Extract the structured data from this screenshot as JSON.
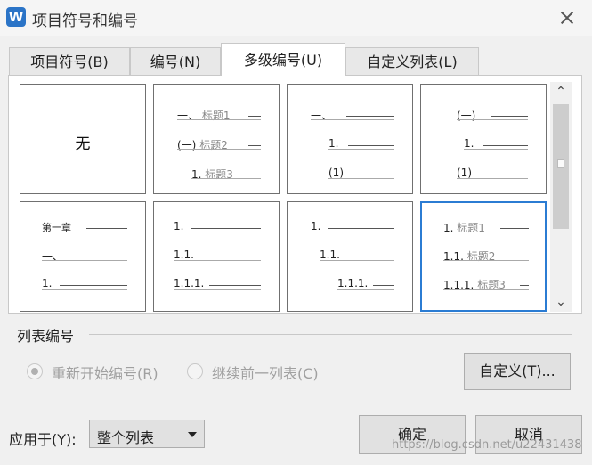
{
  "window": {
    "title": "项目符号和编号",
    "app_icon": "W"
  },
  "tabs": [
    {
      "label": "项目符号(B)",
      "active": false
    },
    {
      "label": "编号(N)",
      "active": false
    },
    {
      "label": "多级编号(U)",
      "active": true
    },
    {
      "label": "自定义列表(L)",
      "active": false
    }
  ],
  "presets": {
    "p1": {
      "label": "无"
    },
    "p2": {
      "r1": "一、",
      "r1h": "标题1",
      "r2": "(一)",
      "r2h": "标题2",
      "r3": "1.",
      "r3h": "标题3"
    },
    "p3": {
      "r1": "一、",
      "r2": "1.",
      "r3": "(1)"
    },
    "p4": {
      "r1": "(一)",
      "r2": "1.",
      "r3": "(1)"
    },
    "p5": {
      "r1": "第一章",
      "r2": "一、",
      "r3": "1."
    },
    "p6": {
      "r1": "1.",
      "r2": "1.1.",
      "r3": "1.1.1."
    },
    "p7": {
      "r1": "1.",
      "r2": "1.1.",
      "r3": "1.1.1."
    },
    "p8": {
      "r1": "1.",
      "r1h": "标题1",
      "r2": "1.1.",
      "r2h": "标题2",
      "r3": "1.1.1.",
      "r3h": "标题3",
      "selected": true
    }
  },
  "list_numbering": {
    "section_label": "列表编号",
    "restart_label": "重新开始编号(R)",
    "continue_label": "继续前一列表(C)",
    "customize_label": "自定义(T)..."
  },
  "footer": {
    "apply_label": "应用于(Y):",
    "apply_value": "整个列表",
    "ok_label": "确定",
    "cancel_label": "取消"
  },
  "watermark": "https://blog.csdn.net/u22431438",
  "colors": {
    "accent": "#2b7cd3",
    "app_icon_bg": "#2b74c7"
  }
}
